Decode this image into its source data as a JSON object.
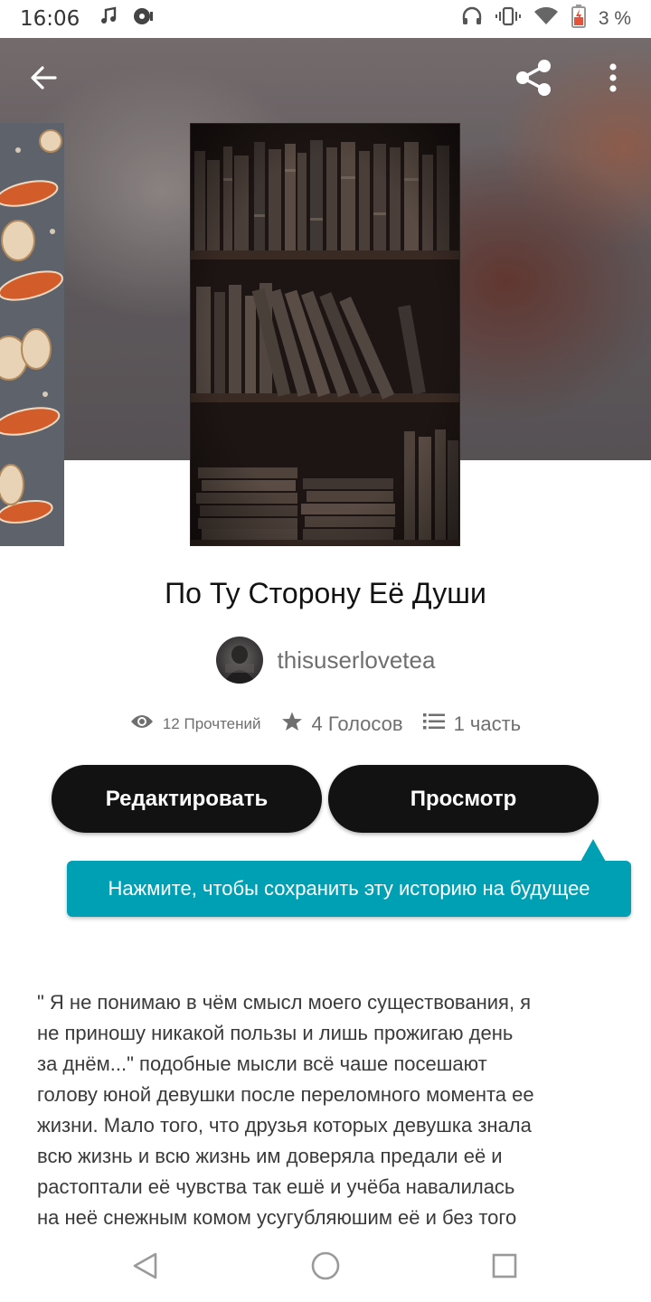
{
  "status_bar": {
    "time": "16:06",
    "battery": "3 %",
    "icons": [
      "music-note-icon",
      "media-icon",
      "headphones-icon",
      "vibrate-icon",
      "wifi-icon",
      "battery-low-icon"
    ]
  },
  "header": {
    "back_icon": "arrow-left-icon",
    "share_icon": "share-icon",
    "more_icon": "more-vertical-icon"
  },
  "story": {
    "title": "По Ту Сторону Её Души",
    "author": "thisuserlovetea",
    "stats": {
      "reads": "12 Прочтений",
      "votes": "4 Голосов",
      "parts": "1 часть"
    },
    "buttons": {
      "edit": "Редактировать",
      "preview": "Просмотр"
    },
    "tooltip": "Нажмите, чтобы сохранить эту историю на будущее",
    "description": "\" Я не понимаю в чём смысл моего существования, я\nне приношу никакой пользы и лишь прожигаю день\nза днём...\" подобные мысли всё чаше посешают\nголову юной девушки после переломного момента ее\nжизни. Мало того, что друзья которых девушка знала\nвсю жизнь и всю жизнь им доверяла предали её и\nрастоптали её чувства так ешё и учёба навалилась\nна неё снежным комом усугубляюшим  её и без того"
  },
  "colors": {
    "button_bg": "#121212",
    "tooltip_bg": "#00a0b4",
    "text_secondary": "#6f6f6f"
  },
  "nav": {
    "back": "nav-back-icon",
    "home": "nav-home-icon",
    "recents": "nav-recents-icon"
  }
}
